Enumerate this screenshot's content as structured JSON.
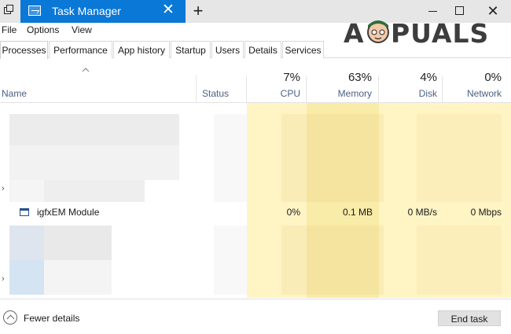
{
  "window": {
    "tab_title": "Task Manager",
    "close_glyph": "✕",
    "new_tab_glyph": "+",
    "min_glyph": "",
    "close_window_glyph": "✕"
  },
  "watermark": {
    "text": "APPUALS"
  },
  "menu": {
    "items": [
      "File",
      "Options",
      "View"
    ]
  },
  "tabs": {
    "items": [
      "Processes",
      "Performance",
      "App history",
      "Startup",
      "Users",
      "Details",
      "Services"
    ],
    "active": "Processes"
  },
  "columns": {
    "name": "Name",
    "status": "Status",
    "cpu": {
      "percent": "7%",
      "label": "CPU"
    },
    "memory": {
      "percent": "63%",
      "label": "Memory"
    },
    "disk": {
      "percent": "4%",
      "label": "Disk"
    },
    "network": {
      "percent": "0%",
      "label": "Network"
    }
  },
  "rows": {
    "focused": {
      "name": "igfxEM Module",
      "cpu": "0%",
      "memory": "0.1 MB",
      "disk": "0 MB/s",
      "network": "0 Mbps"
    }
  },
  "colors": {
    "accent": "#0a78d7",
    "heat_light": "#fff4c4",
    "heat_medium": "#f9eba8",
    "header_text": "#4d6082"
  },
  "footer": {
    "fewer_details": "Fewer details",
    "end_task": "End task"
  }
}
